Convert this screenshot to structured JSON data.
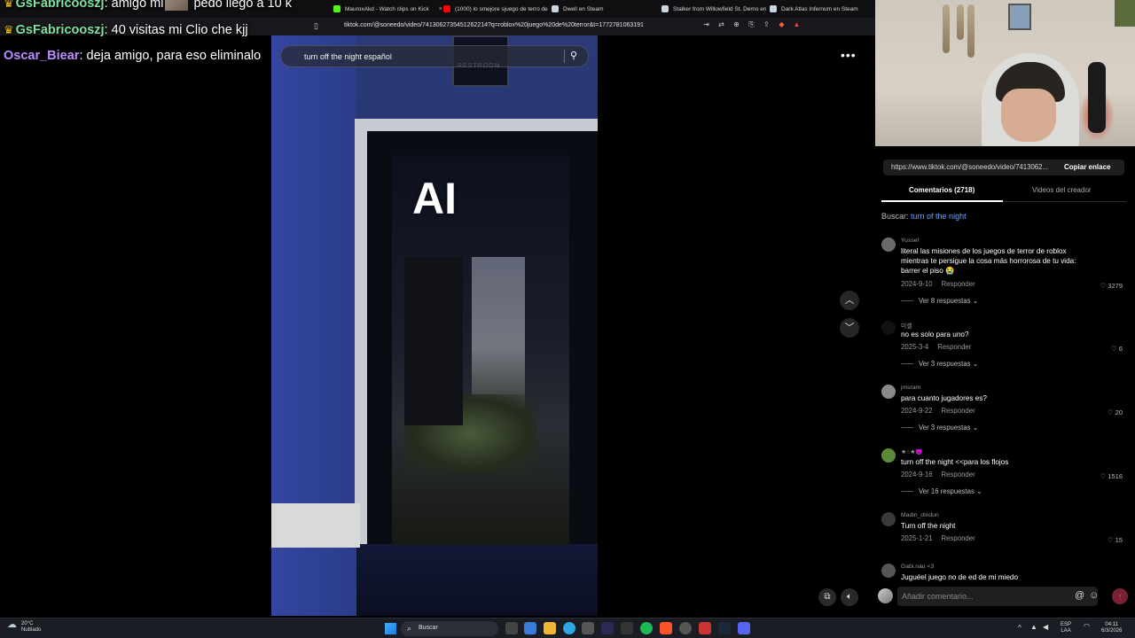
{
  "browser": {
    "tabs": [
      {
        "label": "",
        "color": "#53fc18"
      },
      {
        "label": "MauroxAkd - Watch clips on Kick",
        "color": "#53fc18"
      },
      {
        "label": "(1000) lo smejore sjuego de terro de",
        "color": "#ff0000"
      },
      {
        "label": "Dwell en Steam",
        "color": "#c7d5e0"
      },
      {
        "label": "Stalker from Willowfield St. Demo en",
        "color": "#c7d5e0"
      },
      {
        "label": "Dark Atlas Infernum en Steam",
        "color": "#c7d5e0"
      }
    ],
    "url": "tiktok.com/@soneedo/video/7413062735451262214?q=roblox%20juego%20de%20terror&t=1772781063191"
  },
  "chat": [
    {
      "badge": "crown",
      "user": "GsFabricooszj",
      "user_color": "#7fe0a0",
      "message": ": amigo mi",
      "message_tail": " pedo llego a 10 k"
    },
    {
      "badge": "crown",
      "user": "GsFabricooszj",
      "user_color": "#7fe0a0",
      "message": ": 40 visitas mi Clio che kjj"
    },
    {
      "badge": "",
      "user": "Oscar_Biear",
      "user_color": "#b98cff",
      "message": ": deja amigo, para eso eliminalo"
    }
  ],
  "video": {
    "overlay_text": "AI",
    "sign_text": "RESTROOM",
    "search_query": "turn off the night español"
  },
  "tiktok_panel": {
    "share_url": "https://www.tiktok.com/@soneedo/video/7413062...",
    "copy_label": "Copiar enlace",
    "tabs": [
      "Comentarios (2718)",
      "Videos del creador"
    ],
    "search_prefix": "Buscar:",
    "search_term": "turn of the night",
    "comments": [
      {
        "user": "Yussef",
        "text": "literal las misiones de los juegos de terror de roblox mientras te persigue la cosa más horrorosa de tu vida: barrer el piso 😭",
        "date": "2024-9-10",
        "reply": "Responder",
        "likes": "3279",
        "replies": "Ver 8 respuestas",
        "avatar": "#6a6a6a"
      },
      {
        "user": "미셸",
        "text": "no es solo para uno?",
        "date": "2025-3-4",
        "reply": "Responder",
        "likes": "6",
        "replies": "Ver 3 respuestas",
        "avatar": "#111111"
      },
      {
        "user": "jmsram",
        "text": "para cuanto jugadores es?",
        "date": "2024-9-22",
        "reply": "Responder",
        "likes": "20",
        "replies": "Ver 3 respuestas",
        "avatar": "#8a8a8a"
      },
      {
        "user": "★○★😈",
        "text": "turn off the night <<para los flojos",
        "date": "2024-9-16",
        "reply": "Responder",
        "likes": "1516",
        "replies": "Ver 16 respuestas",
        "avatar": "#5d8a3a"
      },
      {
        "user": "Madin_dindun",
        "text": "Turn off the night",
        "date": "2025-1-21",
        "reply": "Responder",
        "likes": "15",
        "replies": "",
        "avatar": "#3a3a3a"
      },
      {
        "user": "Gabi.nau <3",
        "text": "Juguéel juego no de ed de mi miedo",
        "date": "",
        "reply": "",
        "likes": "",
        "replies": "",
        "avatar": "#555555"
      }
    ],
    "comment_placeholder": "Añadir comentario...",
    "at_icon": "@",
    "emoji_icon": "☺"
  },
  "taskbar": {
    "weather_temp": "20°C",
    "weather_desc": "Nublado",
    "search_label": "Buscar",
    "lang": "ESP",
    "lang_sub": "LAA",
    "time": "04:11",
    "date": "6/3/2026"
  }
}
